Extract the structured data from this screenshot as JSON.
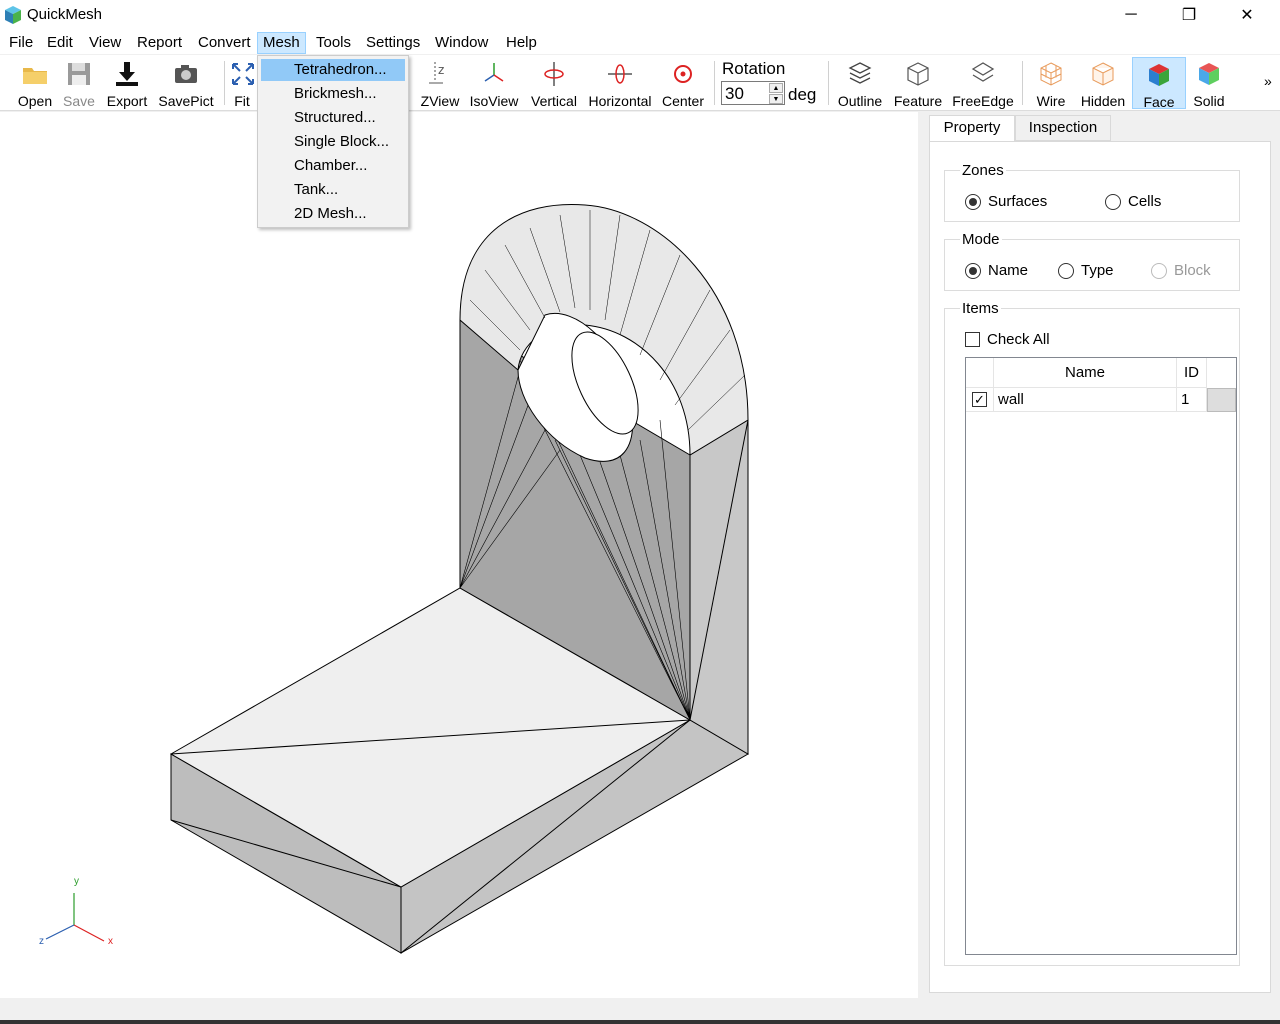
{
  "app": {
    "title": "QuickMesh"
  },
  "window_controls": {
    "minimize": "─",
    "maximize": "❐",
    "close": "✕"
  },
  "menubar": {
    "items": [
      "File",
      "Edit",
      "View",
      "Report",
      "Convert",
      "Mesh",
      "Tools",
      "Settings",
      "Window",
      "Help"
    ],
    "active": "Mesh"
  },
  "mesh_menu": {
    "items": [
      "Tetrahedron...",
      "Brickmesh...",
      "Structured...",
      "Single Block...",
      "Chamber...",
      "Tank...",
      "2D Mesh..."
    ],
    "highlighted": "Tetrahedron..."
  },
  "toolbar": {
    "open": "Open",
    "save": "Save",
    "export": "Export",
    "savepict": "SavePict",
    "fit": "Fit",
    "zview": "ZView",
    "isoview": "IsoView",
    "vertical": "Vertical",
    "horizontal": "Horizontal",
    "center": "Center",
    "rotation_label": "Rotation",
    "rotation_value": "30",
    "rotation_unit": "deg",
    "outline": "Outline",
    "feature": "Feature",
    "freeedge": "FreeEdge",
    "wire": "Wire",
    "hidden": "Hidden",
    "face": "Face",
    "solid": "Solid",
    "more": "»"
  },
  "axes": {
    "y": "y",
    "z": "z",
    "x": "x"
  },
  "panel": {
    "tabs": {
      "property": "Property",
      "inspection": "Inspection"
    },
    "zones": {
      "title": "Zones",
      "surfaces": "Surfaces",
      "cells": "Cells",
      "selected": "Surfaces"
    },
    "mode": {
      "title": "Mode",
      "name": "Name",
      "type": "Type",
      "block": "Block",
      "selected": "Name"
    },
    "items": {
      "title": "Items",
      "check_all": "Check All",
      "columns": {
        "name": "Name",
        "id": "ID"
      },
      "rows": [
        {
          "checked": true,
          "name": "wall",
          "id": "1"
        }
      ]
    }
  },
  "colors": {
    "accent": "#cce8ff",
    "highlight": "#91c9f7"
  }
}
